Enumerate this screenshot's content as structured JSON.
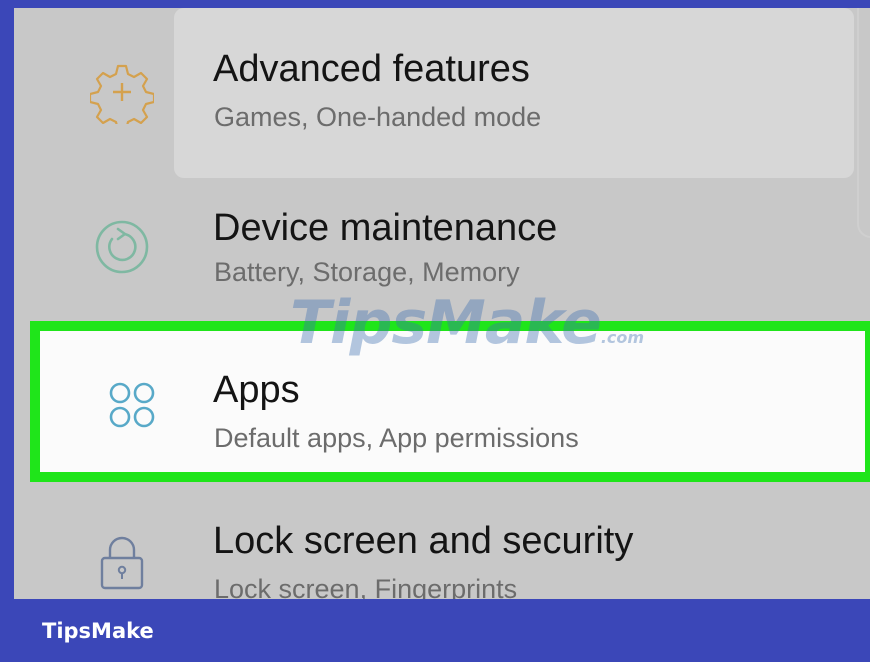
{
  "settings_list": {
    "items": [
      {
        "title": "Advanced features",
        "subtitle": "Games, One-handed mode",
        "icon": "gear-plus-icon"
      },
      {
        "title": "Device maintenance",
        "subtitle": "Battery, Storage, Memory",
        "icon": "refresh-circle-icon"
      },
      {
        "title": "Apps",
        "subtitle": "Default apps, App permissions",
        "icon": "apps-grid-icon",
        "highlighted": true
      },
      {
        "title": "Lock screen and security",
        "subtitle": "Lock screen, Fingerprints",
        "icon": "lock-icon"
      }
    ]
  },
  "watermark": {
    "main": "TipsMake",
    "suffix": ".com"
  },
  "footer": {
    "brand": "TipsMake"
  },
  "colors": {
    "frame": "#3b47b8",
    "highlight_border": "#1fe51a",
    "gear_icon": "#d4a14e",
    "refresh_icon": "#7fb8a2",
    "apps_icon": "#58a9c8",
    "lock_icon": "#6f7f9e"
  }
}
